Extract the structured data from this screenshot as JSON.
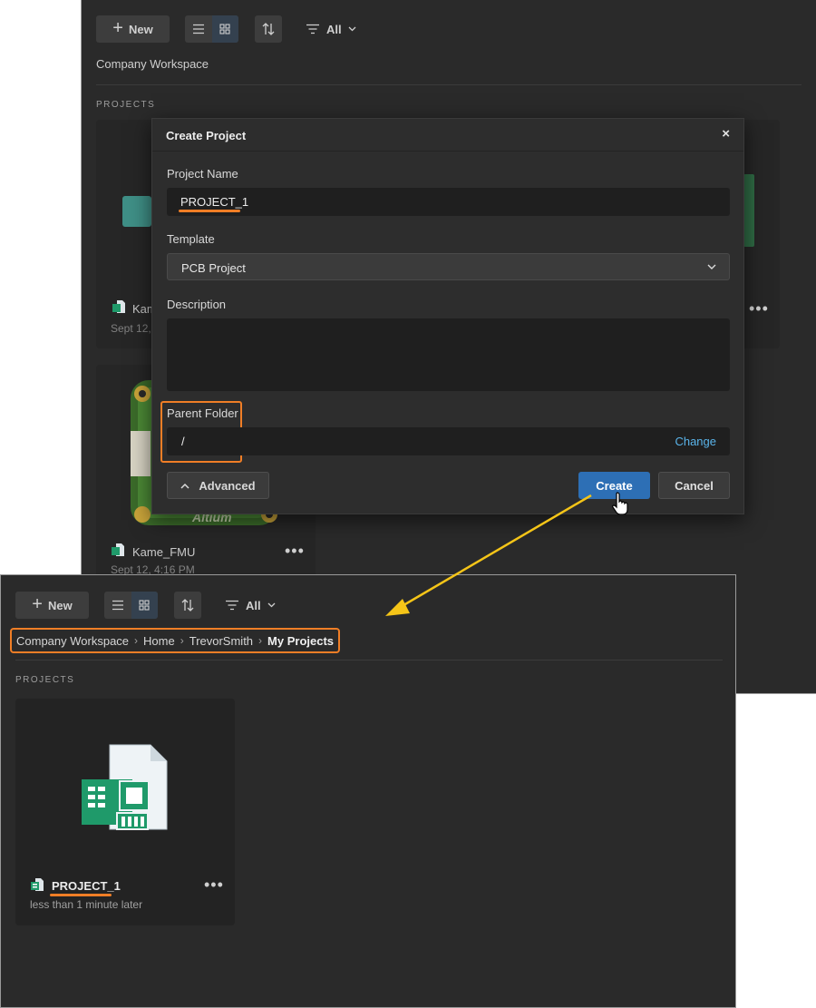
{
  "toolbar": {
    "new_label": "New",
    "filter_label": "All"
  },
  "top_panel": {
    "workspace_title": "Company Workspace",
    "section_label": "PROJECTS",
    "cards": [
      {
        "name": "Kame_",
        "date": "Sept 12,"
      },
      {
        "name": "Kame_FMU",
        "date": "Sept 12, 4:16 PM"
      }
    ],
    "board_brand": "Altium"
  },
  "modal": {
    "title": "Create Project",
    "close_symbol": "×",
    "project_name_label": "Project Name",
    "project_name_value": "PROJECT_1",
    "template_label": "Template",
    "template_value": "PCB Project",
    "description_label": "Description",
    "description_value": "",
    "parent_folder_label": "Parent Folder",
    "parent_folder_value": "/",
    "change_label": "Change",
    "advanced_label": "Advanced",
    "create_label": "Create",
    "cancel_label": "Cancel"
  },
  "bottom_panel": {
    "breadcrumb": [
      "Company Workspace",
      "Home",
      "TrevorSmith",
      "My Projects"
    ],
    "section_label": "PROJECTS",
    "project": {
      "name": "PROJECT_1",
      "modified": "less than 1 minute later"
    }
  },
  "colors": {
    "highlight": "#f07e26",
    "arrow": "#f5c518",
    "primary_button": "#2d6fb5",
    "link": "#5ab4ea",
    "panel_bg": "#2a2a2a",
    "pcb_green": "#1f9a6a"
  }
}
